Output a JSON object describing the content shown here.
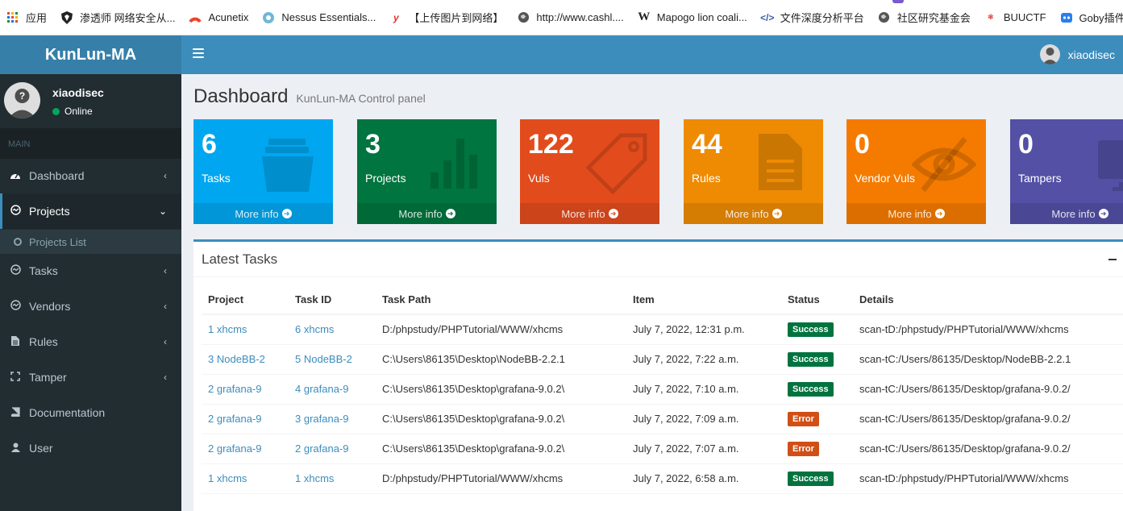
{
  "bookmarks": [
    {
      "icon": "apps-grid-icon",
      "label": "应用"
    },
    {
      "icon": "shield-icon",
      "label": "渗透师 网络安全从..."
    },
    {
      "icon": "acunetix-icon",
      "label": "Acunetix"
    },
    {
      "icon": "nessus-icon",
      "label": "Nessus Essentials..."
    },
    {
      "icon": "y-logo-icon",
      "label": "【上传图片到网络】"
    },
    {
      "icon": "globe-icon",
      "label": "http://www.cashl...."
    },
    {
      "icon": "w-logo-icon",
      "label": "Mapogo lion coali..."
    },
    {
      "icon": "eye-link-icon",
      "label": "文件深度分析平台"
    },
    {
      "icon": "globe-icon",
      "label": "社区研究基金会"
    },
    {
      "icon": "buuctf-icon",
      "label": "BUUCTF"
    },
    {
      "icon": "goby-icon",
      "label": "Goby插件开发教程..."
    }
  ],
  "brand": "KunLun-MA",
  "navbar": {
    "username": "xiaodisec"
  },
  "sidebar": {
    "user": {
      "name": "xiaodisec",
      "status": "Online"
    },
    "header": "MAIN",
    "items": [
      {
        "label": "Dashboard",
        "icon": "dashboard-icon",
        "chevron": "‹"
      },
      {
        "label": "Projects",
        "icon": "projects-icon",
        "chevron": "⌄"
      },
      {
        "label": "Tasks",
        "icon": "tasks-icon",
        "chevron": "‹"
      },
      {
        "label": "Vendors",
        "icon": "vendors-icon",
        "chevron": "‹"
      },
      {
        "label": "Rules",
        "icon": "rules-icon",
        "chevron": "‹"
      },
      {
        "label": "Tamper",
        "icon": "tamper-icon",
        "chevron": "‹"
      },
      {
        "label": "Documentation",
        "icon": "book-icon",
        "chevron": ""
      },
      {
        "label": "User",
        "icon": "user-icon",
        "chevron": ""
      }
    ],
    "subitem": "Projects List"
  },
  "page": {
    "title": "Dashboard",
    "subtitle": "KunLun-MA Control panel"
  },
  "stats": [
    {
      "value": "6",
      "label": "Tasks",
      "more": "More info",
      "color": "#00a7f0",
      "icon": "inbox-icon"
    },
    {
      "value": "3",
      "label": "Projects",
      "more": "More info",
      "color": "#00753f",
      "icon": "bar-chart-icon"
    },
    {
      "value": "122",
      "label": "Vuls",
      "more": "More info",
      "color": "#e24c1d",
      "icon": "tag-icon"
    },
    {
      "value": "44",
      "label": "Rules",
      "more": "More info",
      "color": "#ee8b03",
      "icon": "document-icon"
    },
    {
      "value": "0",
      "label": "Vendor Vuls",
      "more": "More info",
      "color": "#f57b00",
      "icon": "eye-slash-icon"
    },
    {
      "value": "0",
      "label": "Tampers",
      "more": "More info",
      "color": "#5350a6",
      "icon": "monitor-icon"
    }
  ],
  "latest": {
    "title": "Latest Tasks",
    "columns": [
      "Project",
      "Task ID",
      "Task Path",
      "Item",
      "Status",
      "Details"
    ],
    "rows": [
      {
        "project": "1 xhcms",
        "task": "6 xhcms",
        "path": "D:/phpstudy/PHPTutorial/WWW/xhcms",
        "item": "July 7, 2022, 12:31 p.m.",
        "status": "Success",
        "details": "scan-tD:/phpstudy/PHPTutorial/WWW/xhcms"
      },
      {
        "project": "3 NodeBB-2",
        "task": "5 NodeBB-2",
        "path": "C:\\Users\\86135\\Desktop\\NodeBB-2.2.1",
        "item": "July 7, 2022, 7:22 a.m.",
        "status": "Success",
        "details": "scan-tC:/Users/86135/Desktop/NodeBB-2.2.1"
      },
      {
        "project": "2 grafana-9",
        "task": "4 grafana-9",
        "path": "C:\\Users\\86135\\Desktop\\grafana-9.0.2\\",
        "item": "July 7, 2022, 7:10 a.m.",
        "status": "Success",
        "details": "scan-tC:/Users/86135/Desktop/grafana-9.0.2/"
      },
      {
        "project": "2 grafana-9",
        "task": "3 grafana-9",
        "path": "C:\\Users\\86135\\Desktop\\grafana-9.0.2\\",
        "item": "July 7, 2022, 7:09 a.m.",
        "status": "Error",
        "details": "scan-tC:/Users/86135/Desktop/grafana-9.0.2/"
      },
      {
        "project": "2 grafana-9",
        "task": "2 grafana-9",
        "path": "C:\\Users\\86135\\Desktop\\grafana-9.0.2\\",
        "item": "July 7, 2022, 7:07 a.m.",
        "status": "Error",
        "details": "scan-tC:/Users/86135/Desktop/grafana-9.0.2/"
      },
      {
        "project": "1 xhcms",
        "task": "1 xhcms",
        "path": "D:/phpstudy/PHPTutorial/WWW/xhcms",
        "item": "July 7, 2022, 6:58 a.m.",
        "status": "Success",
        "details": "scan-tD:/phpstudy/PHPTutorial/WWW/xhcms"
      }
    ]
  }
}
